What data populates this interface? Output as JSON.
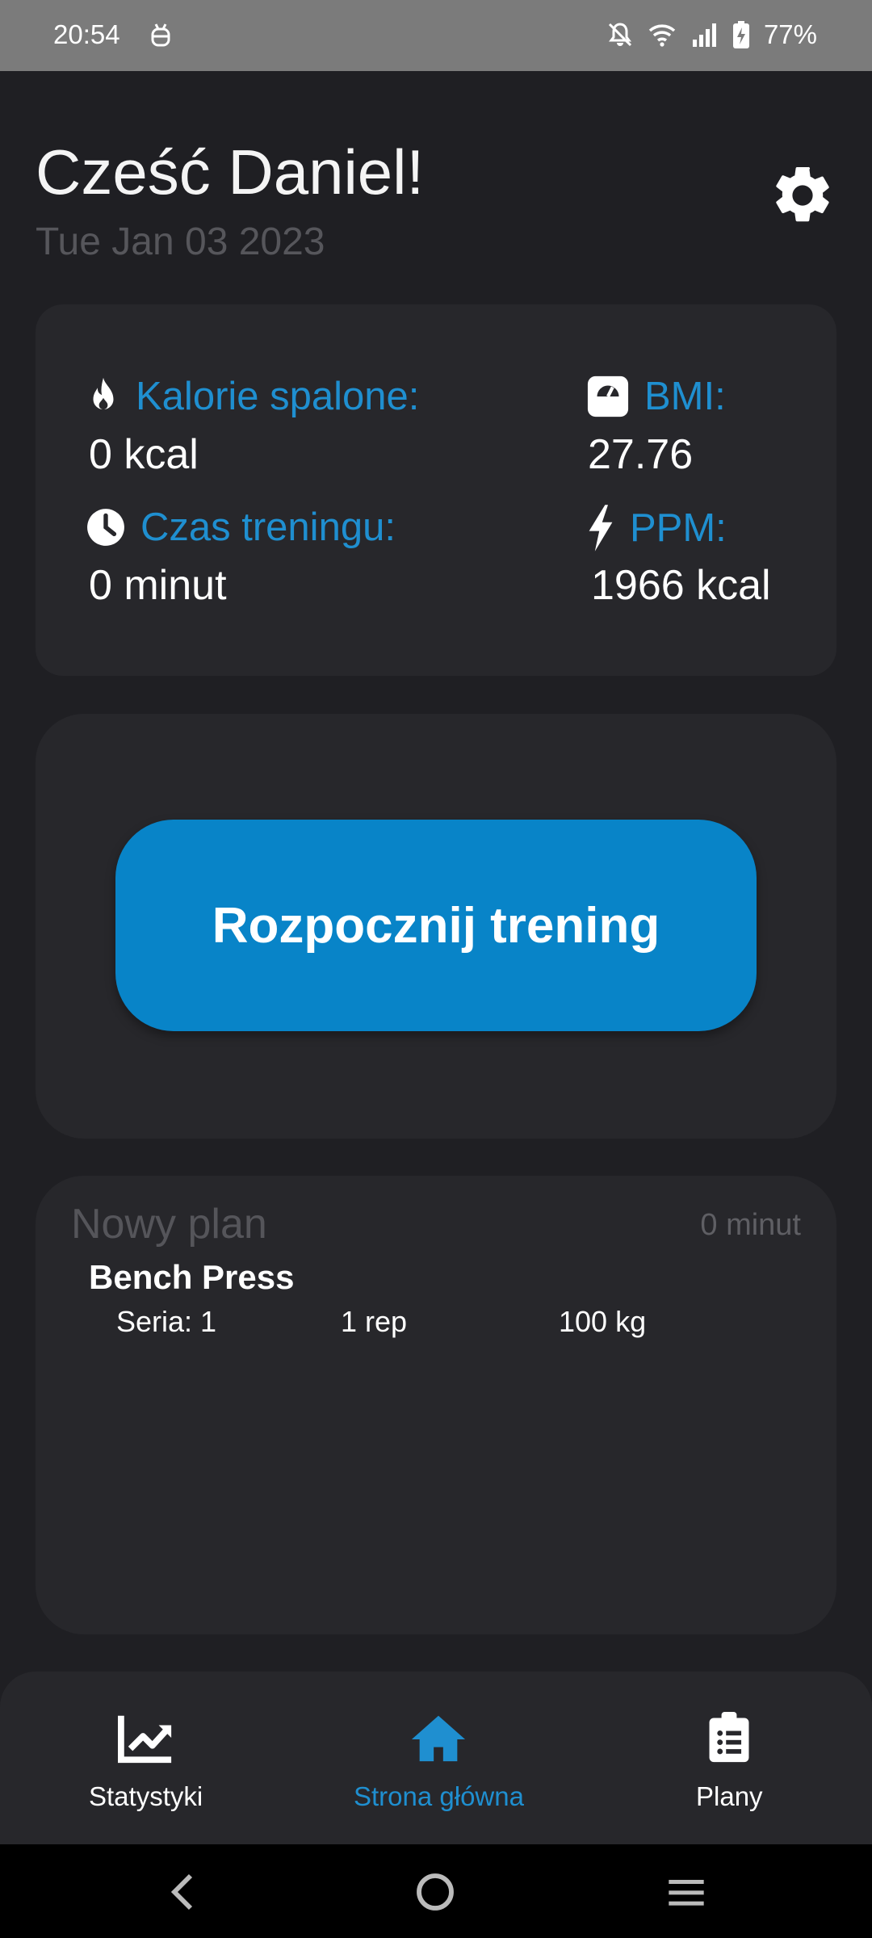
{
  "status_bar": {
    "time": "20:54",
    "battery_percent": "77%",
    "icons": [
      "android-debug-icon",
      "bell-off-icon",
      "wifi-icon",
      "signal-icon",
      "battery-charging-icon"
    ]
  },
  "header": {
    "greeting": "Cześć Daniel!",
    "date": "Tue Jan 03 2023",
    "settings_icon": "gear-icon"
  },
  "stats": {
    "calories_label": "Kalorie spalone:",
    "calories_value": "0 kcal",
    "bmi_label": "BMI:",
    "bmi_value": "27.76",
    "time_label": "Czas treningu:",
    "time_value": "0 minut",
    "ppm_label": "PPM:",
    "ppm_value": "1966 kcal"
  },
  "start": {
    "button_label": "Rozpocznij trening"
  },
  "plan": {
    "title": "Nowy plan",
    "duration": "0 minut",
    "exercises": [
      {
        "name": "Bench Press",
        "sets": [
          {
            "series": "Seria: 1",
            "reps": "1 rep",
            "weight": "100 kg"
          }
        ]
      }
    ]
  },
  "bottom_nav": {
    "items": [
      {
        "label": "Statystyki",
        "icon": "chart-icon",
        "active": false
      },
      {
        "label": "Strona główna",
        "icon": "home-icon",
        "active": true
      },
      {
        "label": "Plany",
        "icon": "clipboard-list-icon",
        "active": false
      }
    ]
  },
  "colors": {
    "background": "#1f1f23",
    "card": "#27272b",
    "accent": "#1f8fd0",
    "button": "#0884c8",
    "status_bar": "#7b7b7b"
  }
}
